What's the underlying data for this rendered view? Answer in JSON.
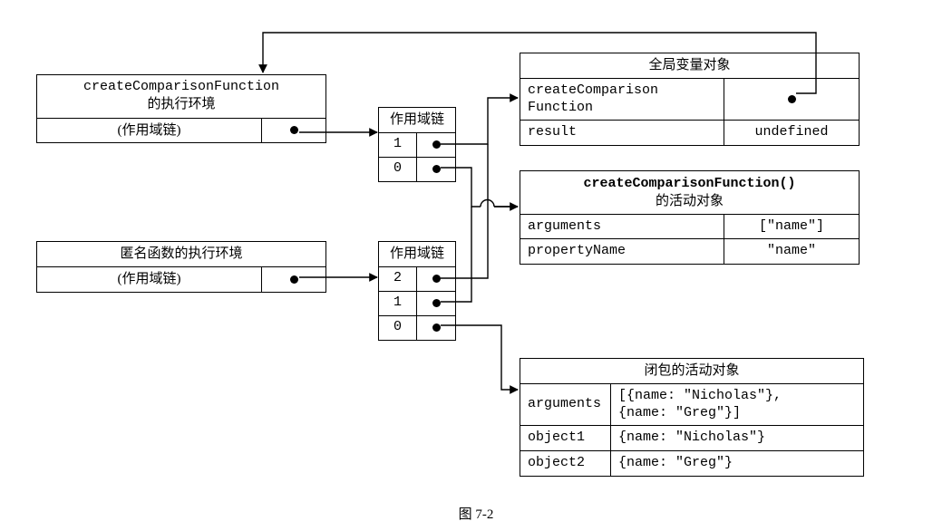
{
  "caption": "图  7-2",
  "exec_ctx_1": {
    "title_line1": "createComparisonFunction",
    "title_line2": "的执行环境",
    "scope_label": "(作用域链)"
  },
  "exec_ctx_2": {
    "title": "匿名函数的执行环境",
    "scope_label": "(作用域链)"
  },
  "scope_chain_1": {
    "title": "作用域链",
    "idx0": "1",
    "idx1": "0"
  },
  "scope_chain_2": {
    "title": "作用域链",
    "idx0": "2",
    "idx1": "1",
    "idx2": "0"
  },
  "global_obj": {
    "title": "全局变量对象",
    "row1_key": "createComparison\nFunction",
    "row2_key": "result",
    "row2_val": "undefined"
  },
  "act_obj_ccf": {
    "title_line1": "createComparisonFunction()",
    "title_line2": "的活动对象",
    "row1_key": "arguments",
    "row1_val": "[\"name\"]",
    "row2_key": "propertyName",
    "row2_val": "\"name\""
  },
  "act_obj_closure": {
    "title": "闭包的活动对象",
    "row1_key": "arguments",
    "row1_val": "[{name: \"Nicholas\"},\n {name: \"Greg\"}]",
    "row2_key": "object1",
    "row2_val": "{name: \"Nicholas\"}",
    "row3_key": "object2",
    "row3_val": "{name: \"Greg\"}"
  }
}
